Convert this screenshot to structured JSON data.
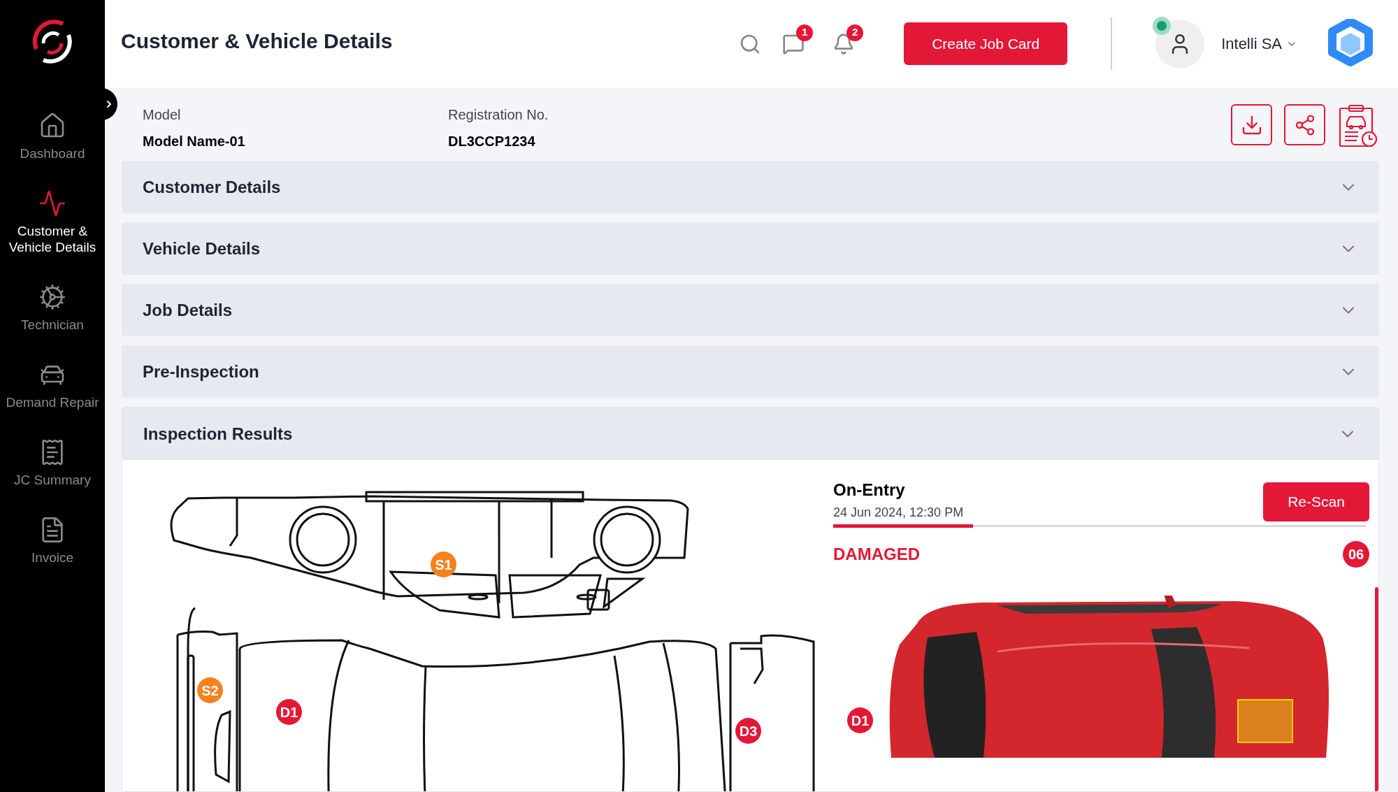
{
  "sidebar": {
    "items": [
      {
        "label": "Dashboard",
        "selected": false
      },
      {
        "label": "Customer & Vehicle Details",
        "selected": true
      },
      {
        "label": "Technician",
        "selected": false
      },
      {
        "label": "Demand Repair",
        "selected": false
      },
      {
        "label": "JC Summary",
        "selected": false
      },
      {
        "label": "Invoice",
        "selected": false
      }
    ]
  },
  "header": {
    "title": "Customer & Vehicle Details",
    "messages_badge": "1",
    "notifications_badge": "2",
    "create_button": "Create Job Card",
    "user": {
      "name": "Intelli SA",
      "online": true
    }
  },
  "vehicle": {
    "fields": [
      {
        "label": "Model",
        "value": "Model Name-01"
      },
      {
        "label": "Registration No.",
        "value": "DL3CCP1234"
      }
    ]
  },
  "sections": [
    {
      "title": "Customer Details",
      "expanded": false
    },
    {
      "title": "Vehicle Details",
      "expanded": false
    },
    {
      "title": "Job Details",
      "expanded": false
    },
    {
      "title": "Pre-Inspection",
      "expanded": false
    },
    {
      "title": "Inspection Results",
      "expanded": true
    }
  ],
  "inspection": {
    "diagram_markers": [
      {
        "label": "S1",
        "color": "#f5821f"
      },
      {
        "label": "S2",
        "color": "#f5821f"
      },
      {
        "label": "D1",
        "color": "#e31837"
      },
      {
        "label": "D3",
        "color": "#e31837"
      }
    ],
    "scan": {
      "title": "On-Entry",
      "timestamp": "24 Jun 2024, 12:30 PM",
      "rescan_button": "Re-Scan",
      "status": "DAMAGED",
      "count": "06",
      "photo_markers": [
        {
          "label": "D1",
          "color": "#e31837"
        }
      ]
    }
  }
}
